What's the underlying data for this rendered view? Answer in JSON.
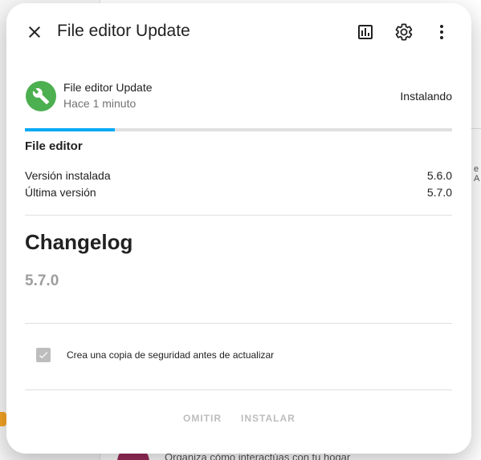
{
  "background": {
    "edge_text": "e A",
    "bottom_text": "Organiza cómo interactúas con tu hogar"
  },
  "dialog": {
    "title": "File editor Update",
    "icons": {
      "close": "close-icon",
      "history": "chart-box-icon",
      "settings": "gear-icon",
      "more": "dots-vertical-icon"
    }
  },
  "entity": {
    "icon": "wrench-icon",
    "name": "File editor Update",
    "last_changed": "Hace 1 minuto",
    "state": "Instalando"
  },
  "progress": {
    "value": 0.21,
    "color": "#03a9f4"
  },
  "details": {
    "title": "File editor",
    "installed_label": "Versión instalada",
    "installed_value": "5.6.0",
    "latest_label": "Última versión",
    "latest_value": "5.7.0"
  },
  "changelog": {
    "title": "Changelog",
    "version": "5.7.0"
  },
  "backup": {
    "checked": true,
    "label": "Crea una copia de seguridad antes de actualizar"
  },
  "actions": {
    "skip_label": "OMITIR",
    "install_label": "INSTALAR"
  },
  "colors": {
    "entity_icon_bg": "#4caf50",
    "progress": "#03a9f4",
    "disabled": "#bdbdbd"
  }
}
